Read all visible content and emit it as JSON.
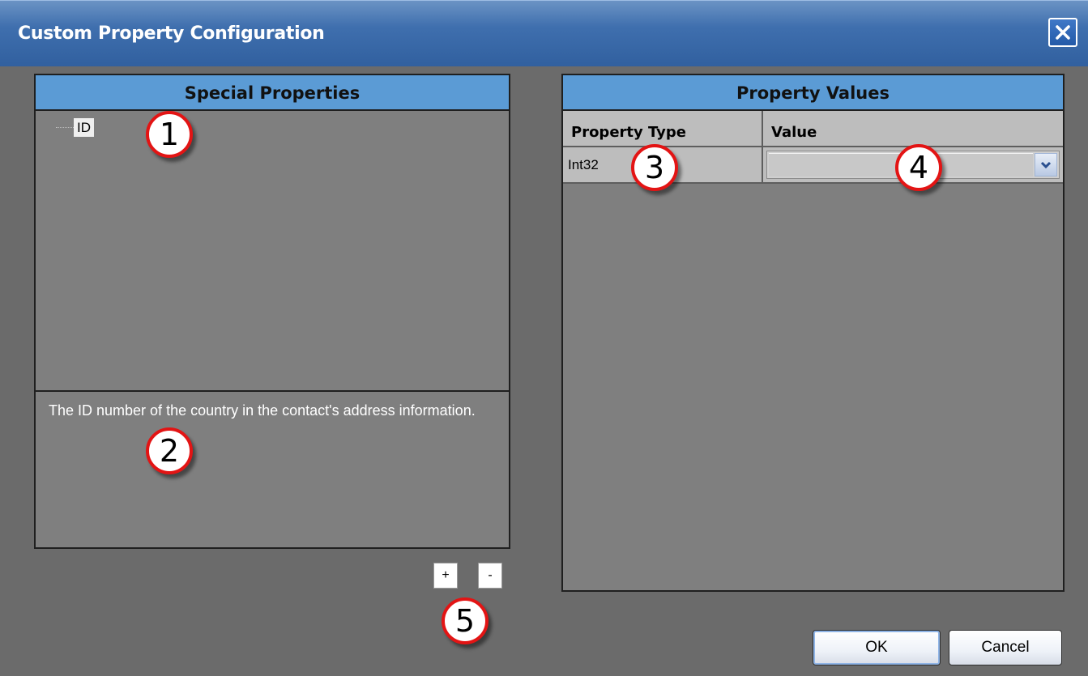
{
  "window": {
    "title": "Custom Property Configuration"
  },
  "special_properties": {
    "header": "Special Properties",
    "tree_items": [
      {
        "label": "ID"
      }
    ],
    "description": "The ID number of the country in the contact's address information."
  },
  "property_values": {
    "header": "Property Values",
    "columns": [
      "Property Type",
      "Value"
    ],
    "rows": [
      {
        "type": "Int32",
        "value": ""
      }
    ]
  },
  "buttons": {
    "add_label": "+",
    "remove_label": "-",
    "ok_label": "OK",
    "cancel_label": "Cancel"
  },
  "callouts": [
    "1",
    "2",
    "3",
    "4",
    "5"
  ],
  "icons": {
    "close": "close-icon",
    "dropdown": "chevron-down-icon"
  }
}
